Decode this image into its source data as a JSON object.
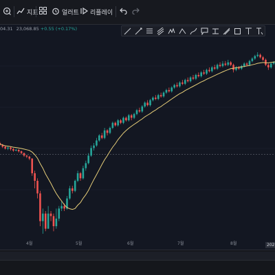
{
  "toolbar": {
    "indicators_label": "지표",
    "alerts_label": "얼러트",
    "replay_label": "리플레이"
  },
  "legend": {
    "price_fragment": "04.31",
    "close_fragment": "23,068.85",
    "change": "+0.55 (+0.17%)"
  },
  "drawing_tools": [
    "trend-line",
    "ray",
    "fib-retracement",
    "regression",
    "pattern",
    "long-position",
    "brush",
    "text-note",
    "date-range",
    "measure",
    "rectangle",
    "text",
    "anchored-text"
  ],
  "chart_data": {
    "type": "candlestick",
    "x_tick_labels": [
      "4월",
      "5월",
      "6월",
      "7월",
      "8월"
    ],
    "last_date_label": "2025",
    "moving_average": "yellow line",
    "reference_line": "dashed horizontal",
    "colors": {
      "up": "#26a69a",
      "down": "#ef5350",
      "ma": "#e8cf7a",
      "grid": "#1e2230"
    },
    "candles": [
      [
        19840,
        19800,
        19920,
        19760
      ],
      [
        19800,
        19720,
        19850,
        19690
      ],
      [
        19720,
        19650,
        19760,
        19600
      ],
      [
        19650,
        19580,
        19700,
        19540
      ],
      [
        19580,
        19620,
        19650,
        19520
      ],
      [
        19620,
        19560,
        19660,
        19500
      ],
      [
        19560,
        19500,
        19600,
        19450
      ],
      [
        19500,
        19530,
        19570,
        19470
      ],
      [
        19530,
        19470,
        19560,
        19420
      ],
      [
        19470,
        19400,
        19500,
        19350
      ],
      [
        19400,
        19300,
        19420,
        19250
      ],
      [
        19300,
        19260,
        19330,
        19200
      ],
      [
        19260,
        19180,
        19290,
        19120
      ],
      [
        19180,
        18600,
        19200,
        18500
      ],
      [
        18600,
        18300,
        18700,
        18000
      ],
      [
        18300,
        17800,
        18400,
        17600
      ],
      [
        17800,
        16700,
        17900,
        16500
      ],
      [
        16700,
        17000,
        17200,
        16200
      ],
      [
        17000,
        16400,
        17100,
        16300
      ],
      [
        16400,
        17000,
        17300,
        16400
      ],
      [
        17000,
        16900,
        17100,
        16700
      ],
      [
        16900,
        16500,
        17000,
        16300
      ],
      [
        16500,
        16800,
        17200,
        16400
      ],
      [
        16800,
        17200,
        17300,
        16700
      ],
      [
        17200,
        17300,
        17500,
        17100
      ],
      [
        17300,
        17200,
        17400,
        17100
      ],
      [
        17200,
        17600,
        17700,
        17150
      ],
      [
        17600,
        18000,
        18100,
        17550
      ],
      [
        18000,
        17900,
        18100,
        17800
      ],
      [
        17900,
        18300,
        18350,
        17850
      ],
      [
        18300,
        18600,
        18700,
        18250
      ],
      [
        18600,
        18400,
        18650,
        18300
      ],
      [
        18400,
        18800,
        18900,
        18350
      ],
      [
        18800,
        19000,
        19100,
        18700
      ],
      [
        19000,
        19300,
        19400,
        18950
      ],
      [
        19300,
        19600,
        19700,
        19250
      ],
      [
        19600,
        19700,
        19800,
        19500
      ],
      [
        19700,
        19900,
        20000,
        19650
      ],
      [
        19900,
        20100,
        20150,
        19850
      ],
      [
        20100,
        20000,
        20200,
        19950
      ],
      [
        20000,
        20300,
        20400,
        19950
      ],
      [
        20300,
        20200,
        20350,
        20100
      ],
      [
        20200,
        20400,
        20450,
        20150
      ],
      [
        20400,
        20600,
        20650,
        20350
      ],
      [
        20600,
        20500,
        20650,
        20450
      ],
      [
        20500,
        20700,
        20750,
        20450
      ],
      [
        20700,
        20600,
        20750,
        20550
      ],
      [
        20600,
        20800,
        20850,
        20550
      ],
      [
        20800,
        20700,
        20850,
        20650
      ],
      [
        20700,
        20900,
        20950,
        20650
      ],
      [
        20900,
        20800,
        20950,
        20700
      ],
      [
        20800,
        20950,
        21000,
        20750
      ],
      [
        20950,
        21100,
        21150,
        20900
      ],
      [
        21100,
        21050,
        21200,
        21000
      ],
      [
        21050,
        21250,
        21300,
        21000
      ],
      [
        21250,
        21400,
        21450,
        21200
      ],
      [
        21400,
        21300,
        21500,
        21250
      ],
      [
        21300,
        21500,
        21550,
        21250
      ],
      [
        21500,
        21600,
        21650,
        21450
      ],
      [
        21600,
        21550,
        21700,
        21500
      ],
      [
        21550,
        21700,
        21750,
        21500
      ],
      [
        21700,
        21650,
        21800,
        21600
      ],
      [
        21650,
        21800,
        21850,
        21600
      ],
      [
        21800,
        21900,
        21950,
        21750
      ],
      [
        21900,
        21850,
        22000,
        21800
      ],
      [
        21850,
        22000,
        22050,
        21800
      ],
      [
        22000,
        22100,
        22150,
        21950
      ],
      [
        22100,
        22050,
        22200,
        22000
      ],
      [
        22050,
        22200,
        22250,
        22000
      ],
      [
        22200,
        22150,
        22300,
        22100
      ],
      [
        22150,
        22300,
        22350,
        22100
      ],
      [
        22300,
        22250,
        22400,
        22200
      ],
      [
        22250,
        22400,
        22450,
        22200
      ],
      [
        22400,
        22350,
        22500,
        22300
      ],
      [
        22350,
        22500,
        22550,
        22300
      ],
      [
        22500,
        22450,
        22600,
        22400
      ],
      [
        22450,
        22600,
        22650,
        22400
      ],
      [
        22600,
        22550,
        22700,
        22500
      ],
      [
        22550,
        22700,
        22750,
        22500
      ],
      [
        22700,
        22650,
        22800,
        22600
      ],
      [
        22650,
        22800,
        22850,
        22600
      ],
      [
        22800,
        22750,
        22900,
        22700
      ],
      [
        22750,
        22900,
        22950,
        22700
      ],
      [
        22900,
        22850,
        23000,
        22800
      ],
      [
        22850,
        22950,
        23050,
        22800
      ],
      [
        22950,
        22900,
        23050,
        22850
      ],
      [
        22900,
        23000,
        23100,
        22850
      ],
      [
        23000,
        22900,
        23050,
        22850
      ],
      [
        22900,
        22700,
        22950,
        22600
      ],
      [
        22700,
        22800,
        22850,
        22650
      ],
      [
        22800,
        22750,
        22850,
        22700
      ],
      [
        22750,
        22850,
        22900,
        22700
      ],
      [
        22850,
        22950,
        23000,
        22800
      ],
      [
        22950,
        22900,
        23000,
        22850
      ],
      [
        22900,
        23050,
        23100,
        22850
      ],
      [
        23050,
        23150,
        23200,
        23000
      ],
      [
        23150,
        23250,
        23300,
        23100
      ],
      [
        23250,
        23300,
        23400,
        23200
      ],
      [
        23300,
        23200,
        23350,
        23150
      ],
      [
        23200,
        23100,
        23250,
        23050
      ],
      [
        23100,
        22900,
        23150,
        22850
      ],
      [
        22900,
        22800,
        22950,
        22700
      ],
      [
        22800,
        22950,
        23000,
        22750
      ],
      [
        22950,
        23000,
        23050,
        22900
      ],
      [
        23000,
        23068.85,
        23100,
        22950
      ]
    ]
  }
}
